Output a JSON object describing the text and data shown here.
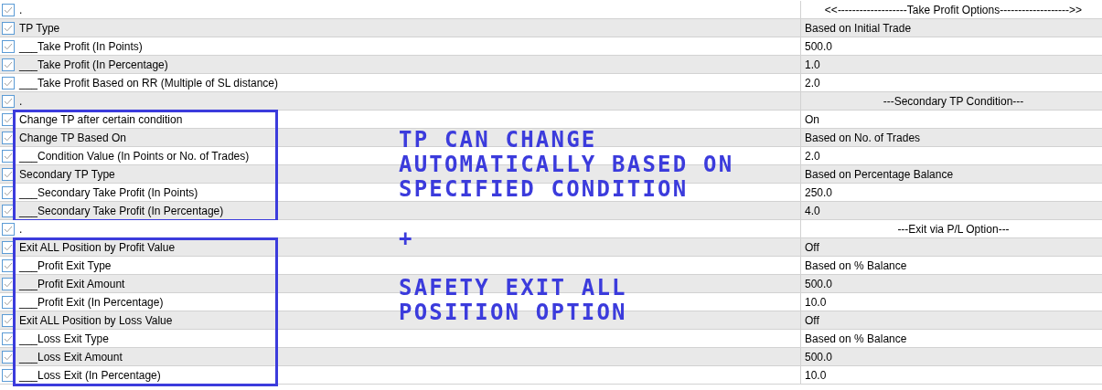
{
  "groups": [
    {
      "boxed": false,
      "rows": [
        {
          "kind": "separator",
          "name": ".",
          "value": "<<-------------------Take Profit Options------------------->>",
          "checked": true
        },
        {
          "kind": "param",
          "name": "TP Type",
          "value": "Based on Initial Trade",
          "checked": true
        },
        {
          "kind": "param",
          "name": "___Take Profit (In Points)",
          "value": "500.0",
          "checked": true
        },
        {
          "kind": "param",
          "name": "___Take Profit (In Percentage)",
          "value": "1.0",
          "checked": true
        },
        {
          "kind": "param",
          "name": "___Take Profit Based on RR (Multiple of SL distance)",
          "value": "2.0",
          "checked": true
        },
        {
          "kind": "separator",
          "name": ".",
          "value": "---Secondary TP Condition---",
          "checked": true
        }
      ]
    },
    {
      "boxed": true,
      "rows": [
        {
          "kind": "param",
          "name": "Change TP after certain condition",
          "value": "On",
          "checked": true
        },
        {
          "kind": "param",
          "name": "Change TP Based On",
          "value": "Based on No. of Trades",
          "checked": true
        },
        {
          "kind": "param",
          "name": "___Condition Value (In Points or No. of Trades)",
          "value": "2.0",
          "checked": true
        },
        {
          "kind": "param",
          "name": "Secondary TP Type",
          "value": "Based on Percentage Balance",
          "checked": true
        },
        {
          "kind": "param",
          "name": "___Secondary Take Profit (In Points)",
          "value": "250.0",
          "checked": true
        },
        {
          "kind": "param",
          "name": "___Secondary Take Profit (In Percentage)",
          "value": "4.0",
          "checked": true
        }
      ]
    },
    {
      "boxed": false,
      "rows": [
        {
          "kind": "separator",
          "name": ".",
          "value": "---Exit via P/L Option---",
          "checked": true
        }
      ]
    },
    {
      "boxed": true,
      "rows": [
        {
          "kind": "param",
          "name": "Exit ALL Position by Profit Value",
          "value": "Off",
          "checked": true
        },
        {
          "kind": "param",
          "name": "___Profit Exit Type",
          "value": "Based on % Balance",
          "checked": true
        },
        {
          "kind": "param",
          "name": "___Profit Exit Amount",
          "value": "500.0",
          "checked": true
        },
        {
          "kind": "param",
          "name": "___Profit Exit (In Percentage)",
          "value": "10.0",
          "checked": true
        },
        {
          "kind": "param",
          "name": "Exit ALL Position by Loss Value",
          "value": "Off",
          "checked": true
        },
        {
          "kind": "param",
          "name": "___Loss Exit Type",
          "value": "Based on % Balance",
          "checked": true
        },
        {
          "kind": "param",
          "name": "___Loss Exit Amount",
          "value": "500.0",
          "checked": true
        },
        {
          "kind": "param",
          "name": "___Loss Exit (In Percentage)",
          "value": "10.0",
          "checked": true
        }
      ]
    }
  ],
  "annotations": [
    {
      "lines": [
        "TP CAN CHANGE",
        "AUTOMATICALLY BASED ON",
        "SPECIFIED CONDITION"
      ]
    },
    {
      "lines": [
        "+"
      ]
    },
    {
      "lines": [
        "SAFETY EXIT ALL",
        "POSITION OPTION"
      ]
    }
  ]
}
